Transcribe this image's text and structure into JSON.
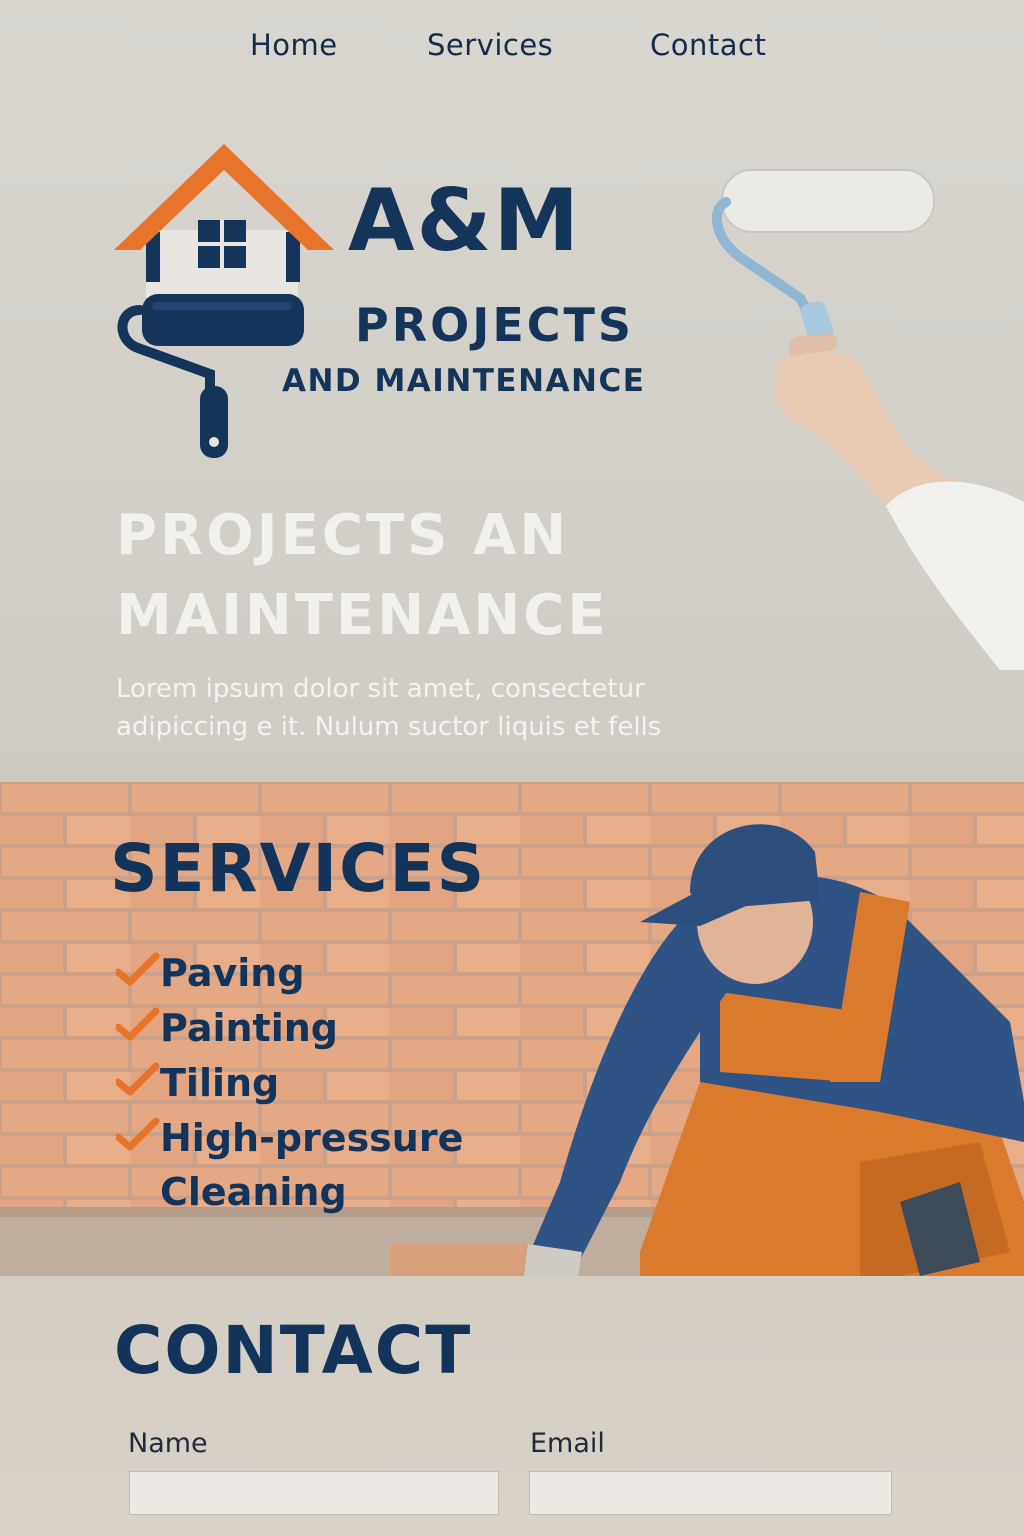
{
  "nav": {
    "items": [
      {
        "label": "Home"
      },
      {
        "label": "Services"
      },
      {
        "label": "Contact"
      }
    ]
  },
  "brand": {
    "name": "A&M",
    "line1": "PROJECTS",
    "line2": "AND MAINTENANCE",
    "colors": {
      "navy": "#14345a",
      "orange": "#e8732a"
    }
  },
  "hero": {
    "title": "PROJECTS AN MAINTENANCE",
    "text": "Lorem ipsum dolor sit amet, consectetur adipiccing e it. Nulum suctor liquis et fells"
  },
  "services": {
    "title": "SERVICES",
    "items": [
      {
        "label": "Paving",
        "icon": "check-icon"
      },
      {
        "label": "Painting",
        "icon": "check-icon"
      },
      {
        "label": "Tiling",
        "icon": "check-icon"
      },
      {
        "label": "High-pressure Cleaning",
        "icon": "check-icon"
      }
    ]
  },
  "contact": {
    "title": "CONTACT",
    "name_label": "Name",
    "email_label": "Email",
    "name_value": "",
    "email_value": ""
  }
}
